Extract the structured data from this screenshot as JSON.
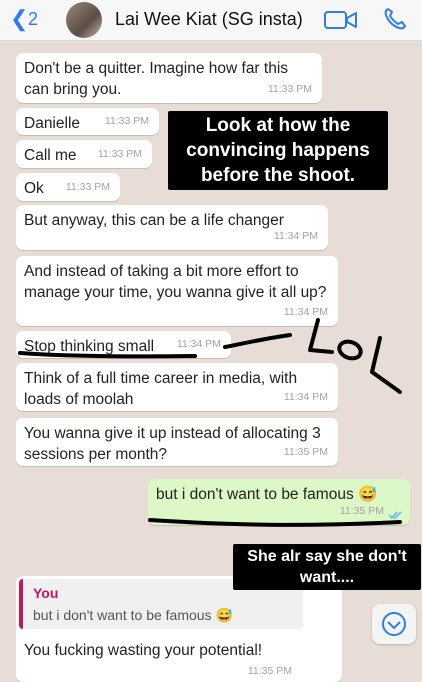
{
  "header": {
    "back_count": "2",
    "contact_name": "Lai Wee Kiat (SG insta)"
  },
  "messages": [
    {
      "text": "Don't be a quitter. Imagine how far this can bring you.",
      "time": "11:33 PM"
    },
    {
      "text": "Danielle",
      "time": "11:33 PM"
    },
    {
      "text": "Call me",
      "time": "11:33 PM"
    },
    {
      "text": "Ok",
      "time": "11:33 PM"
    },
    {
      "text": "But anyway, this can be a life changer",
      "time": "11:34 PM"
    },
    {
      "text": "And instead of taking a bit more effort to manage your time, you wanna give it all up?",
      "time": "11:34 PM"
    },
    {
      "text": "Stop thinking small",
      "time": "11:34 PM"
    },
    {
      "text": "Think of a full time career in media, with loads of moolah",
      "time": "11:34 PM"
    },
    {
      "text": "You wanna give it up instead of allocating 3 sessions per month?",
      "time": "11:35 PM"
    }
  ],
  "outgoing": {
    "text": "but i don't want to be famous 😅",
    "time": "11:35 PM"
  },
  "reply": {
    "quote_author": "You",
    "quote_text": "but i don't want to be famous 😅",
    "text": "You fucking wasting your potential!",
    "time": "11:35 PM"
  },
  "captions": {
    "top": "Look at how the convincing happens before the shoot.",
    "bottom": "She alr say she don't want...."
  },
  "scribble_text": "LOL",
  "icons": {
    "back": "chevron-left-icon",
    "video": "video-call-icon",
    "call": "phone-icon",
    "scroll": "chevron-down-icon"
  },
  "colors": {
    "accent": "#2f7bf0",
    "outgoing_bubble": "#dcf8c6",
    "incoming_bubble": "#ffffff",
    "chat_background": "#e7ddd6",
    "quote_bar": "#c2185b"
  }
}
